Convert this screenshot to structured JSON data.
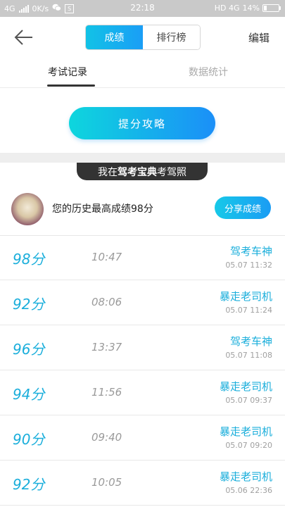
{
  "status_bar": {
    "network_left": "4G",
    "speed": "0K/s",
    "time": "22:18",
    "network_right": "HD 4G",
    "battery_text": "14%"
  },
  "header": {
    "segments": [
      "成绩",
      "排行榜"
    ],
    "active_segment": 0,
    "edit_label": "编辑"
  },
  "tabs": [
    {
      "label": "考试记录",
      "active": true
    },
    {
      "label": "数据统计",
      "active": false
    }
  ],
  "tips_button": "提分攻略",
  "banner": {
    "prefix": "我在",
    "brand": "驾考宝典",
    "suffix": "考驾照"
  },
  "best_score": {
    "text": "您的历史最高成绩98分",
    "share_label": "分享成绩"
  },
  "records": [
    {
      "score": "98分",
      "duration": "10:47",
      "title": "驾考车神",
      "date": "05.07  11:32"
    },
    {
      "score": "92分",
      "duration": "08:06",
      "title": "暴走老司机",
      "date": "05.07  11:24"
    },
    {
      "score": "96分",
      "duration": "13:37",
      "title": "驾考车神",
      "date": "05.07  11:08"
    },
    {
      "score": "94分",
      "duration": "11:56",
      "title": "暴走老司机",
      "date": "05.07  09:37"
    },
    {
      "score": "90分",
      "duration": "09:40",
      "title": "暴走老司机",
      "date": "05.07  09:20"
    },
    {
      "score": "92分",
      "duration": "10:05",
      "title": "暴走老司机",
      "date": "05.06  22:36"
    }
  ],
  "colors": {
    "accent": "#1aaedb",
    "gradient_start": "#0ed6dd",
    "gradient_end": "#1b8ff8"
  }
}
